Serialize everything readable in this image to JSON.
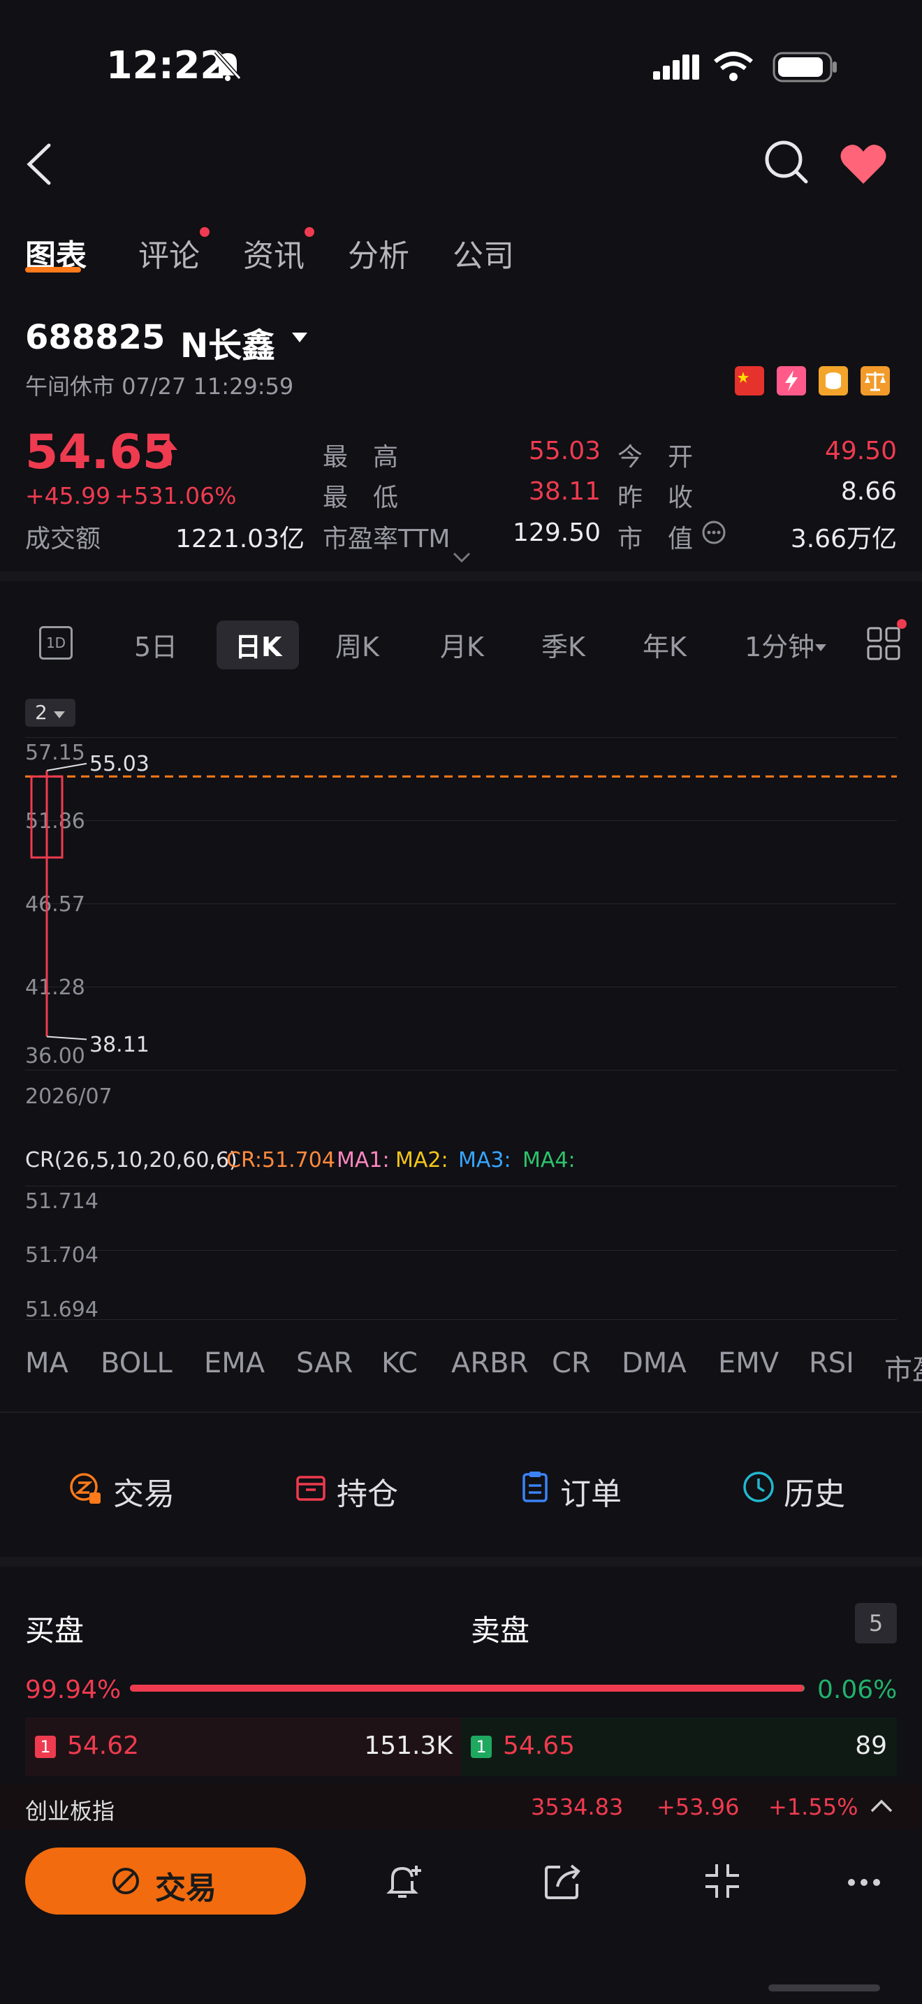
{
  "status": {
    "time": "12:22"
  },
  "tabs": [
    "图表",
    "评论",
    "资讯",
    "分析",
    "公司"
  ],
  "stock": {
    "code": "688825",
    "name": "N长鑫",
    "status": "午间休市 07/27 11:29:59",
    "price": "54.65",
    "change": "+45.99",
    "change_pct": "+531.06%",
    "turnover_label": "成交额",
    "turnover": "1221.03亿",
    "high_label": "最　高",
    "high": "55.03",
    "low_label": "最　低",
    "low": "38.11",
    "pe_label": "市盈率TTM",
    "pe": "129.50",
    "open_label": "今　开",
    "open": "49.50",
    "prev_close_label": "昨　收",
    "prev_close": "8.66",
    "mktcap_label": "市　值",
    "mktcap": "3.66万亿"
  },
  "periods": [
    "1D",
    "5日",
    "日K",
    "周K",
    "月K",
    "季K",
    "年K",
    "1分钟"
  ],
  "chart": {
    "badge": "2",
    "y_ticks": [
      "57.15",
      "51.86",
      "46.57",
      "41.28",
      "36.00"
    ],
    "high_label": "55.03",
    "low_label": "38.11",
    "date": "2026/07",
    "colors": {
      "up": "#ef3b4f",
      "dashed": "#ff7a1a"
    }
  },
  "chart_data": {
    "type": "candlestick",
    "x": [
      "2026/07/27"
    ],
    "open": [
      49.5
    ],
    "high": [
      55.03
    ],
    "low": [
      38.11
    ],
    "close": [
      54.65
    ],
    "ylim": [
      36.0,
      57.15
    ],
    "y_ticks": [
      57.15,
      51.86,
      46.57,
      41.28,
      36.0
    ],
    "reference_line": 54.65
  },
  "cr": {
    "title": "CR(26,5,10,20,60,6)",
    "cr": "CR:51.704",
    "ma1": "MA1:",
    "ma2": "MA2:",
    "ma3": "MA3:",
    "ma4": "MA4:",
    "y_ticks": [
      "51.714",
      "51.704",
      "51.694"
    ]
  },
  "indicators": [
    "MA",
    "BOLL",
    "EMA",
    "SAR",
    "KC",
    "ARBR",
    "CR",
    "DMA",
    "EMV",
    "RSI",
    "市盈"
  ],
  "actions": [
    "交易",
    "持仓",
    "订单",
    "历史"
  ],
  "orderbook": {
    "buy_label": "买盘",
    "sell_label": "卖盘",
    "depth": "5",
    "buy_pct": "99.94%",
    "sell_pct": "0.06%",
    "buy_ratio": 0.9994,
    "bid_level": "1",
    "bid_price": "54.62",
    "bid_vol": "151.3K",
    "ask_level": "1",
    "ask_price": "54.65",
    "ask_vol": "89"
  },
  "ticker": {
    "name": "创业板指",
    "value": "3534.83",
    "change": "+53.96",
    "pct": "+1.55%"
  },
  "bottom": {
    "trade": "交易"
  }
}
